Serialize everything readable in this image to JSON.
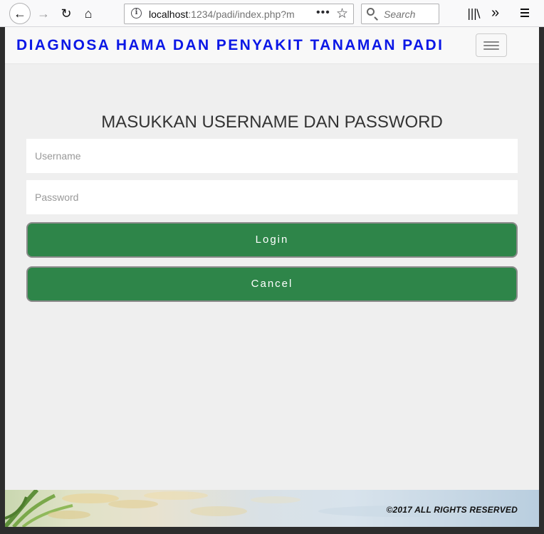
{
  "browser": {
    "url_host": "localhost",
    "url_path": ":1234/padi/index.php?m",
    "search_placeholder": "Search"
  },
  "navbar": {
    "brand": "DIAGNOSA HAMA DAN PENYAKIT TANAMAN PADI"
  },
  "login": {
    "heading": "MASUKKAN USERNAME DAN PASSWORD",
    "username_placeholder": "Username",
    "password_placeholder": "Password",
    "login_label": "Login",
    "cancel_label": "Cancel"
  },
  "footer": {
    "text": "©2017 ALL RIGHTS RESERVED"
  },
  "colors": {
    "brand": "#0b17e6",
    "button": "#2e8549",
    "page_bg": "#efefef"
  }
}
